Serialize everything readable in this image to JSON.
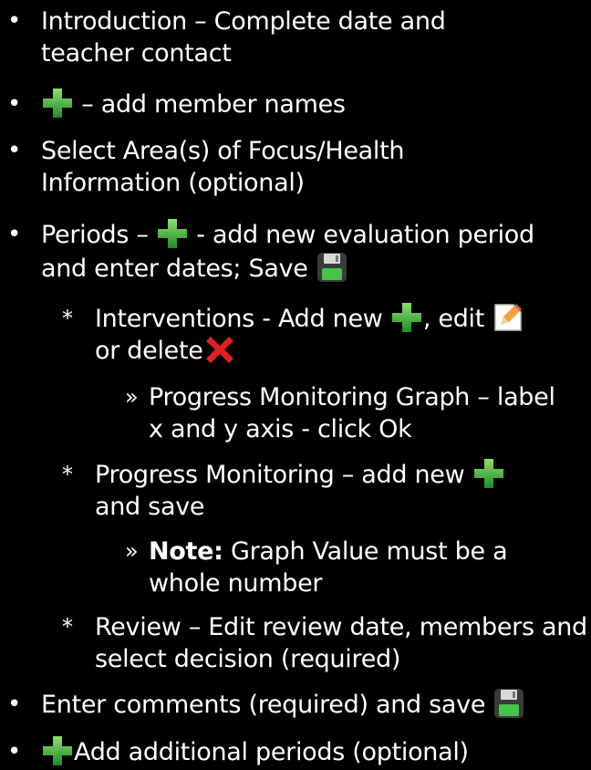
{
  "items": {
    "intro_1": "Introduction – Complete date and",
    "intro_2": "teacher contact",
    "members": "– add member names",
    "area_1": "Select Area(s) of Focus/Health",
    "area_2": "Information (optional)",
    "periods_a": "Periods –",
    "periods_b": "- add new evaluation period",
    "periods_2": "and enter dates; Save",
    "interv_a": "Interventions - Add new",
    "interv_b": ", edit",
    "interv_2": "or delete",
    "graph_1": "Progress Monitoring Graph – label",
    "graph_2": "x and y axis - click Ok",
    "pm_1": "Progress Monitoring – add new",
    "pm_2": "and save",
    "note_bold": "Note:",
    "note_1": " Graph Value must be a",
    "note_2": "whole number",
    "review_1": "Review – Edit review date, members and",
    "review_2": "select decision (required)",
    "comments": "Enter comments (required) and save",
    "additional": "Add additional periods (optional)"
  },
  "glyphs": {
    "bullet": "•",
    "star": "*",
    "raquo": "»"
  },
  "colors": {
    "background": "#000000",
    "text": "#ffffff",
    "plus": "#3fae3f",
    "delete": "#e02020"
  }
}
